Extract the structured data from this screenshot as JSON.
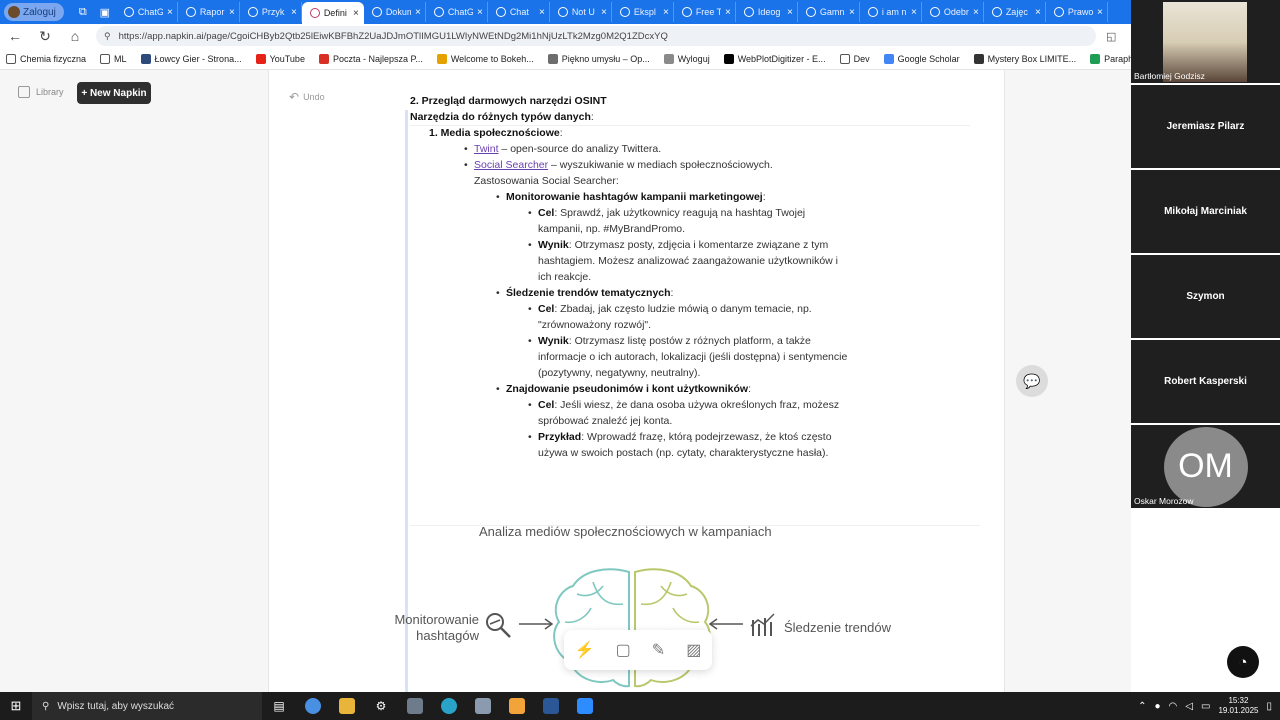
{
  "browser": {
    "profile_label": "Zaloguj",
    "tabs": [
      {
        "title": "ChatG",
        "active": false
      },
      {
        "title": "Rapor",
        "active": false
      },
      {
        "title": "Przyk",
        "active": false
      },
      {
        "title": "Defini",
        "active": true
      },
      {
        "title": "Dokum",
        "active": false
      },
      {
        "title": "ChatG",
        "active": false
      },
      {
        "title": "Chat",
        "active": false
      },
      {
        "title": "Not U",
        "active": false
      },
      {
        "title": "Ekspl",
        "active": false
      },
      {
        "title": "Free T",
        "active": false
      },
      {
        "title": "Ideog",
        "active": false
      },
      {
        "title": "Gamn",
        "active": false
      },
      {
        "title": "i am n",
        "active": false
      },
      {
        "title": "Odebr",
        "active": false
      },
      {
        "title": "Zajęc",
        "active": false
      },
      {
        "title": "Prawo",
        "active": false
      }
    ],
    "url": "https://app.napkin.ai/page/CgoiCHByb2Qtb25lEiwKBFBhZ2UaJDJmOTlIMGU1LWIyNWEtNDg2Mi1hNjUzLTk2Mzg0M2Q1ZDcxYQ",
    "bookmarks": [
      {
        "label": "Chemia fizyczna",
        "icon": "folder-icon",
        "color": "#555555"
      },
      {
        "label": "ML",
        "icon": "folder-icon",
        "color": "#555555"
      },
      {
        "label": "Łowcy Gier - Strona...",
        "icon": "site-icon",
        "color": "#2d4a7a"
      },
      {
        "label": "YouTube",
        "icon": "youtube-icon",
        "color": "#e62117"
      },
      {
        "label": "Poczta - Najlepsza P...",
        "icon": "mail-icon",
        "color": "#d93025"
      },
      {
        "label": "Welcome to Bokeh...",
        "icon": "bokeh-icon",
        "color": "#e5a100"
      },
      {
        "label": "Piękno umysłu – Op...",
        "icon": "site-icon",
        "color": "#6d6d6d"
      },
      {
        "label": "Wyloguj",
        "icon": "site-icon",
        "color": "#8a8a8a"
      },
      {
        "label": "WebPlotDigitizer - E...",
        "icon": "site-icon",
        "color": "#000000"
      },
      {
        "label": "Dev",
        "icon": "folder-icon",
        "color": "#555555"
      },
      {
        "label": "Google Scholar",
        "icon": "scholar-icon",
        "color": "#4285f4"
      },
      {
        "label": "Mystery Box LIMITE...",
        "icon": "site-icon",
        "color": "#333333"
      },
      {
        "label": "Paraphrasing Tool -...",
        "icon": "site-icon",
        "color": "#1f9d55"
      }
    ]
  },
  "sidebar": {
    "library_label": "Library",
    "new_napkin_label": "+ New Napkin"
  },
  "doc": {
    "undo_label": "Undo",
    "heading": "2. Przegląd darmowych narzędzi OSINT",
    "subheading": "Narzędzia do różnych typów danych",
    "section1": "1. Media społecznościowe",
    "twint_name": "Twint",
    "twint_desc": " – open-source do analizy Twittera.",
    "social_name": "Social Searcher",
    "social_desc": " – wyszukiwanie w mediach społecznościowych.",
    "applications": "Zastosowania Social Searcher:",
    "sub1_title": "Monitorowanie hashtagów kampanii marketingowej",
    "sub1_goal_label": "Cel",
    "sub1_goal_l1": ": Sprawdź, jak użytkownicy reagują na hashtag Twojej",
    "sub1_goal_l2": "kampanii, np. #MyBrandPromo.",
    "sub1_res_label": "Wynik",
    "sub1_res_l1": ": Otrzymasz posty, zdjęcia i komentarze związane z tym",
    "sub1_res_l2": "hashtagiem. Możesz analizować zaangażowanie użytkowników i",
    "sub1_res_l3": "ich reakcje.",
    "sub2_title": "Śledzenie trendów tematycznych",
    "sub2_goal_label": "Cel",
    "sub2_goal_l1": ": Zbadaj, jak często ludzie mówią o danym temacie, np.",
    "sub2_goal_l2": "\"zrównoważony rozwój\".",
    "sub2_res_label": "Wynik",
    "sub2_res_l1": ": Otrzymasz listę postów z różnych platform, a także",
    "sub2_res_l2": "informacje o ich autorach, lokalizacji (jeśli dostępna) i sentymencie",
    "sub2_res_l3": "(pozytywny, negatywny, neutralny).",
    "sub3_title": "Znajdowanie pseudonimów i kont użytkowników",
    "sub3_goal_label": "Cel",
    "sub3_goal_l1": ": Jeśli wiesz, że dana osoba używa określonych fraz, możesz",
    "sub3_goal_l2": "spróbować znaleźć jej konta.",
    "sub3_ex_label": "Przykład",
    "sub3_ex_l1": ": Wprowadź frazę, którą podejrzewasz, że ktoś często",
    "sub3_ex_l2": "używa w swoich postach (np. cytaty, charakterystyczne hasła).",
    "diagram_title": "Analiza mediów społecznościowych w kampaniach",
    "diagram_left": "Monitorowanie hashtagów",
    "diagram_right": "Śledzenie trendów"
  },
  "call": {
    "participants": [
      {
        "name": "Bartłomiej Godzisz",
        "video": true
      },
      {
        "name": "Jeremiasz Pilarz",
        "video": false
      },
      {
        "name": "Mikołaj Marciniak",
        "video": false
      },
      {
        "name": "Szymon",
        "video": false
      },
      {
        "name": "Robert Kasperski",
        "video": false
      },
      {
        "name": "Oskar Morozow",
        "video": false,
        "initials": "OM"
      }
    ]
  },
  "taskbar": {
    "search_placeholder": "Wpisz tutaj, aby wyszukać",
    "time": "15:32",
    "date": "19.01.2025"
  },
  "colors": {
    "tab_strip": "#1a73e8",
    "link": "#6a3fb0",
    "diagram_teal": "#7ec8c0",
    "diagram_olive": "#b8c86a"
  }
}
